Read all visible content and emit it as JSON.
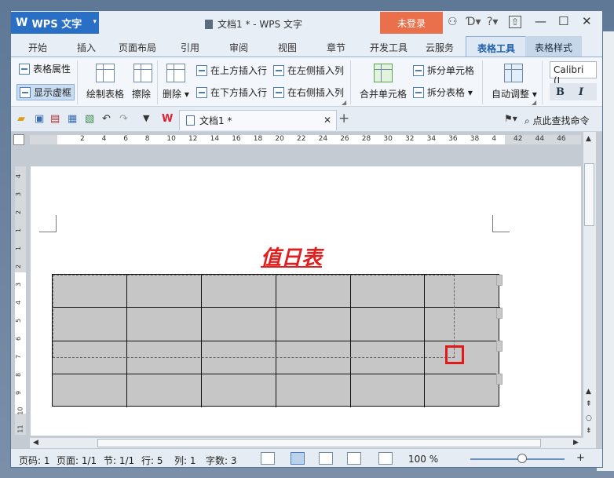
{
  "title_bar": {
    "app_name": "WPS 文字",
    "title": "文档1 * - WPS 文字",
    "login_label": "未登录"
  },
  "tabs": [
    "开始",
    "插入",
    "页面布局",
    "引用",
    "审阅",
    "视图",
    "章节",
    "开发工具",
    "云服务",
    "表格工具",
    "表格样式"
  ],
  "active_tab": "表格工具",
  "ribbon": {
    "table_properties": "表格属性",
    "show_gridlines": "显示虚框",
    "draw_table": "绘制表格",
    "erase": "擦除",
    "delete": "删除 ▾",
    "insert_row_above": "在上方插入行",
    "insert_row_below": "在下方插入行",
    "insert_col_left": "在左侧插入列",
    "insert_col_right": "在右侧插入列",
    "merge_cells": "合并单元格",
    "split_cells": "拆分单元格",
    "split_table": "拆分表格 ▾",
    "auto_fit": "自动调整 ▾",
    "font_name": "Calibri (I",
    "bold": "B",
    "italic": "I"
  },
  "doc_tab": {
    "label": "文档1 *"
  },
  "command_search": {
    "placeholder": "点此查找命令"
  },
  "ruler": {
    "h_ticks": [
      "2",
      "4",
      "6",
      "8",
      "10",
      "12",
      "14",
      "16",
      "18",
      "20",
      "22",
      "24",
      "26",
      "28",
      "30",
      "32",
      "34",
      "36",
      "38",
      "4",
      "42",
      "44",
      "46"
    ],
    "v_ticks": [
      "4",
      "3",
      "2",
      "1",
      "1",
      "2",
      "3",
      "4",
      "5",
      "6",
      "7",
      "8",
      "9",
      "10",
      "11"
    ]
  },
  "document": {
    "title": "值日表"
  },
  "table": {
    "rows": 4,
    "columns": 6
  },
  "status": {
    "page_number": "页码: 1",
    "pages": "页面: 1/1",
    "section": "节: 1/1",
    "line": "行: 5",
    "column": "列: 1",
    "word_count": "字数: 3",
    "zoom": "100 %"
  },
  "colors": {
    "title_text": "#e02020",
    "marker": "#e01a1a",
    "table_fill": "#c6c6c6",
    "app_button": "#2a6fc6",
    "login_button": "#e9704a"
  }
}
